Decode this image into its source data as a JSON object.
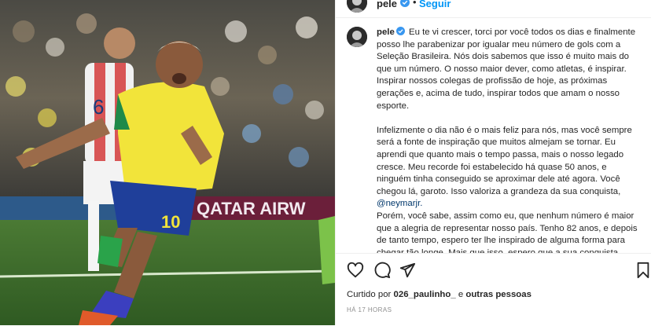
{
  "post": {
    "username": "pele",
    "follow_label": "Seguir",
    "dot": "•",
    "caption_paragraphs": [
      "Eu te vi crescer, torci por você todos os dias e finalmente posso lhe parabenizar por igualar meu número de gols com a Seleção Brasileira. Nós dois sabemos que isso é muito mais do que um número. O nosso maior dever, como atletas, é inspirar. Inspirar nossos colegas de profissão de hoje, as próximas gerações e, acima de tudo, inspirar todos que amam o nosso esporte.",
      "Infelizmente o dia não é o mais feliz para nós, mas você sempre será a fonte de inspiração que muitos almejam se tornar. Eu aprendi que quanto mais o tempo passa, mais o nosso legado cresce. Meu recorde foi estabelecido há quase 50 anos, e ninguém tinha conseguido se aproximar dele até agora. Você chegou lá, garoto. Isso valoriza a grandeza da sua conquista,"
    ],
    "mention": "@neymarjr.",
    "caption_continued": "Porém, você sabe, assim como eu, que nenhum número é maior que a alegria de representar nosso país. Tenho 82 anos, e depois de tanto tempo, espero ter lhe inspirado de alguma forma para chegar tão longe. Mais que isso, espero que a sua conquista",
    "likes_prefix": "Curtido por",
    "likes_user": "026_paulinho_",
    "likes_connector": "e",
    "likes_others": "outras pessoas",
    "timestamp": "HÁ 17 HORAS",
    "photo_banner_text": "QATAR AIRW",
    "jersey_number": "10",
    "opponent_number": "6"
  },
  "icons": [
    "verified-badge-icon",
    "heart-icon",
    "comment-icon",
    "share-icon",
    "bookmark-icon"
  ],
  "colors": {
    "link": "#00376b",
    "follow": "#0095f6",
    "verified": "#3897f0",
    "muted": "#8e8e8e"
  }
}
